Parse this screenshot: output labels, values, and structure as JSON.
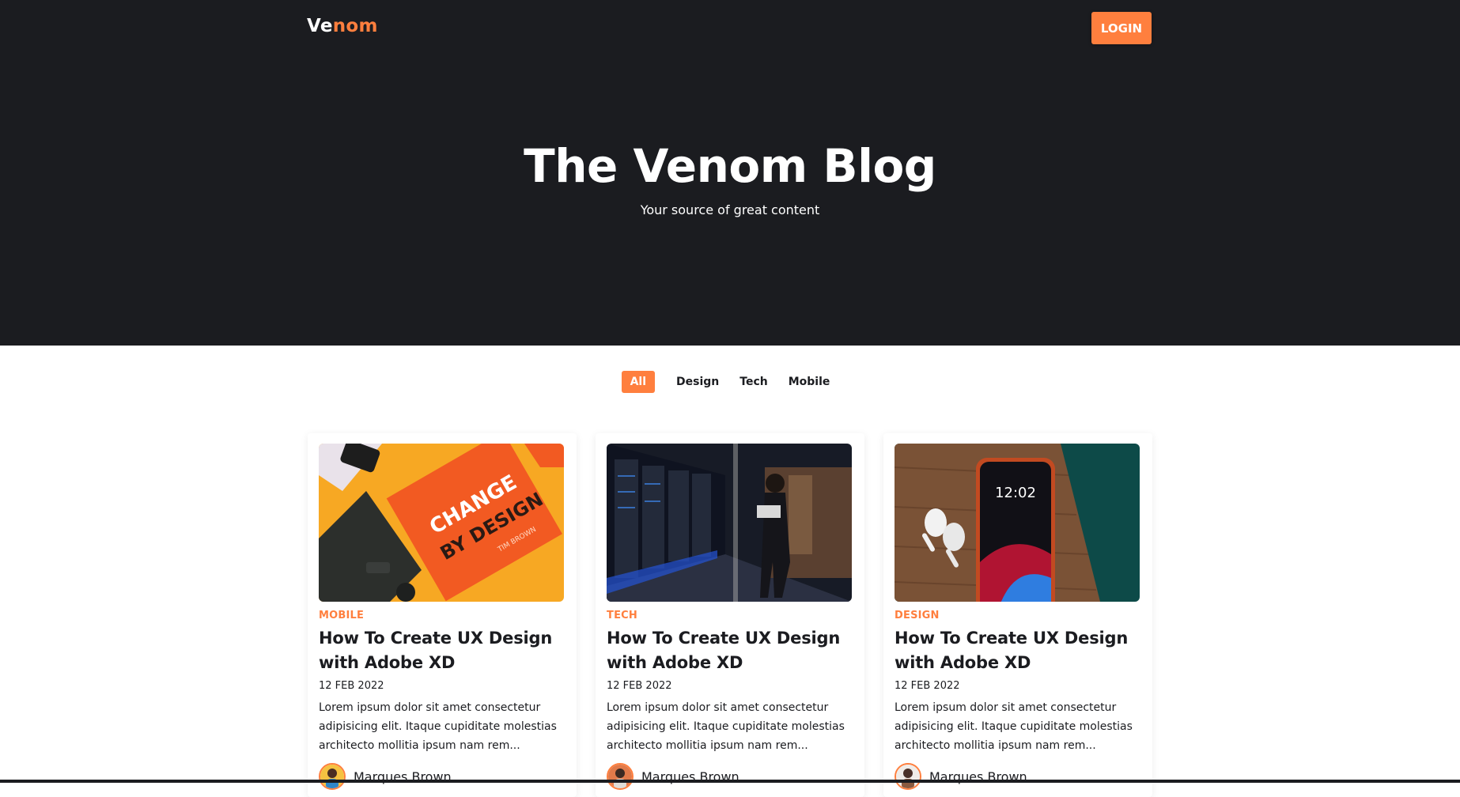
{
  "brand": {
    "logo_part1": "Ve",
    "logo_part2": "nom",
    "accent": "#ff7f3e",
    "dark": "#1b1c20"
  },
  "header": {
    "login_label": "LOGIN"
  },
  "hero": {
    "title": "The Venom Blog",
    "subtitle": "Your source of great content"
  },
  "filters": [
    {
      "label": "All",
      "active": true
    },
    {
      "label": "Design",
      "active": false
    },
    {
      "label": "Tech",
      "active": false
    },
    {
      "label": "Mobile",
      "active": false
    }
  ],
  "posts": [
    {
      "category": "MOBILE",
      "title": "How To Create UX Design with Adobe XD",
      "date": "12 FEB 2022",
      "excerpt": "Lorem ipsum dolor sit amet consectetur adipisicing elit. Itaque cupiditate molestias architecto mollitia ipsum nam rem...",
      "author": "Marques Brown",
      "image": "change-by-design-book",
      "book_title_top": "CHANGE",
      "book_title_bottom": "BY DESIGN",
      "book_author": "TIM BROWN"
    },
    {
      "category": "TECH",
      "title": "How To Create UX Design with Adobe XD",
      "date": "12 FEB 2022",
      "excerpt": "Lorem ipsum dolor sit amet consectetur adipisicing elit. Itaque cupiditate molestias architecto mollitia ipsum nam rem...",
      "author": "Marques Brown",
      "image": "server-room-woman-laptop"
    },
    {
      "category": "DESIGN",
      "title": "How To Create UX Design with Adobe XD",
      "date": "12 FEB 2022",
      "excerpt": "Lorem ipsum dolor sit amet consectetur adipisicing elit. Itaque cupiditate molestias architecto mollitia ipsum nam rem...",
      "author": "Marques Brown",
      "image": "iphone-airpods-wood",
      "phone_time": "12:02"
    }
  ]
}
